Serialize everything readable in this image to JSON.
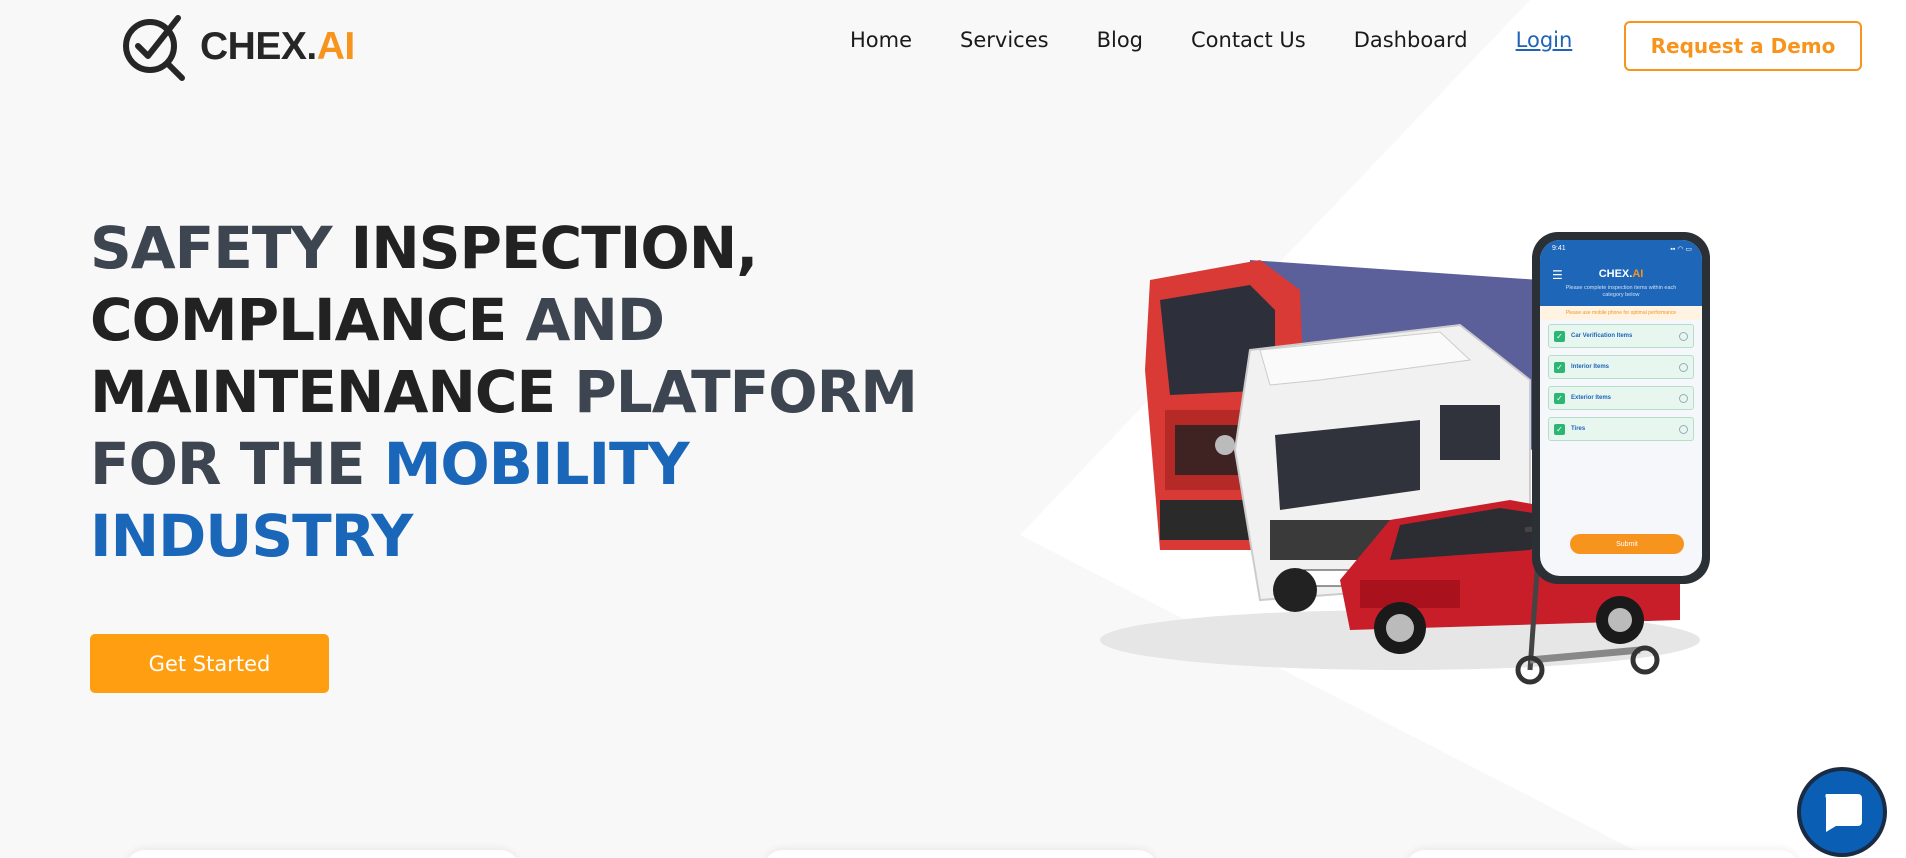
{
  "brand": {
    "name_main": "CHEX.",
    "name_accent": "AI",
    "accent_color": "#f7941d",
    "primary_color": "#1a67b9"
  },
  "nav": {
    "items": [
      {
        "label": "Home"
      },
      {
        "label": "Services"
      },
      {
        "label": "Blog"
      },
      {
        "label": "Contact Us"
      },
      {
        "label": "Dashboard"
      },
      {
        "label": "Login"
      }
    ],
    "cta_label": "Request a Demo"
  },
  "hero": {
    "line1_a": "SAFETY ",
    "line1_b": "INSPECTION,",
    "line2_a": "COMPLIANCE ",
    "line2_b": "AND",
    "line3_a": "MAINTENANCE ",
    "line3_b": "PLATFORM",
    "line4_a": "FOR THE ",
    "line4_b": "MOBILITY",
    "line5": "INDUSTRY",
    "cta_label": "Get Started"
  },
  "phone": {
    "time": "9:41",
    "status": "▪▪ ◠ ▭",
    "menu_icon": "hamburger-icon",
    "logo_main": "CHEX.",
    "logo_accent": "AI",
    "subtitle": "Please complete inspection items within each category below",
    "warning": "Please use mobile phone for optimal performance",
    "items": [
      {
        "label": "Car Verification Items"
      },
      {
        "label": "Interior Items"
      },
      {
        "label": "Exterior Items"
      },
      {
        "label": "Tires"
      }
    ],
    "submit_label": "Submit"
  },
  "chat": {
    "icon": "chat-icon"
  }
}
